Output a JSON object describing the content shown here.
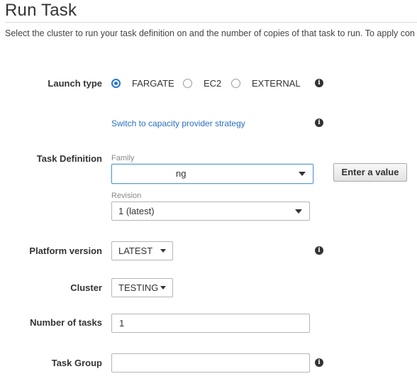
{
  "page": {
    "title": "Run Task",
    "description": "Select the cluster to run your task definition on and the number of copies of that task to run. To apply con"
  },
  "launch_type": {
    "label": "Launch type",
    "options": [
      "FARGATE",
      "EC2",
      "EXTERNAL"
    ],
    "selected": "FARGATE",
    "switch_link": "Switch to capacity provider strategy"
  },
  "task_definition": {
    "label": "Task Definition",
    "family_label": "Family",
    "family_value": "ng",
    "enter_value_button": "Enter a value",
    "revision_label": "Revision",
    "revision_value": "1 (latest)"
  },
  "platform_version": {
    "label": "Platform version",
    "value": "LATEST"
  },
  "cluster": {
    "label": "Cluster",
    "value": "TESTING"
  },
  "number_of_tasks": {
    "label": "Number of tasks",
    "value": "1"
  },
  "task_group": {
    "label": "Task Group",
    "value": "",
    "placeholder": ""
  },
  "icons": {
    "info": "i"
  },
  "colors": {
    "accent": "#2775d0",
    "link": "#2a6fbf"
  }
}
